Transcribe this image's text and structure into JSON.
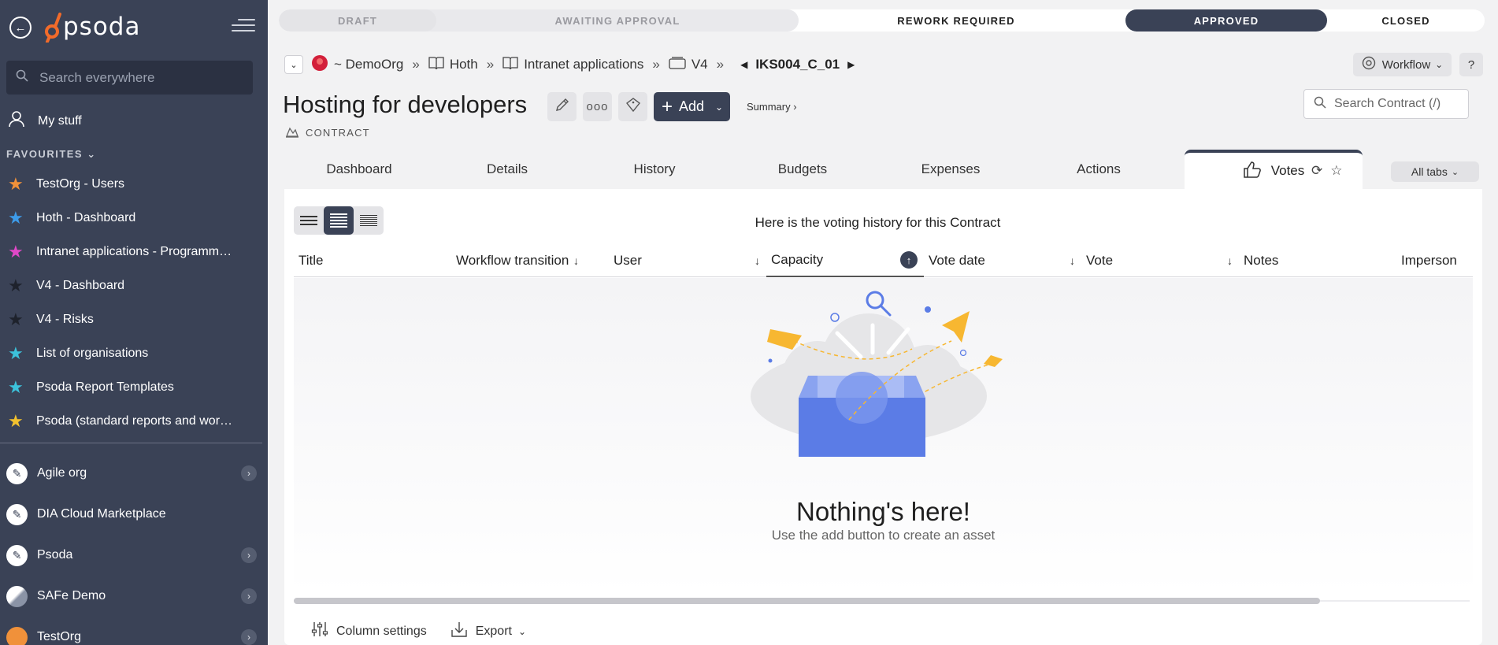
{
  "sidebar": {
    "logo_text": "psoda",
    "search_placeholder": "Search everywhere",
    "mystuff_label": "My stuff",
    "favourites_heading": "FAVOURITES",
    "favourites": [
      {
        "label": "TestOrg - Users",
        "color": "#f0913a"
      },
      {
        "label": "Hoth - Dashboard",
        "color": "#3d9be9"
      },
      {
        "label": "Intranet applications - Programme...",
        "color": "#e048c8"
      },
      {
        "label": "V4 - Dashboard",
        "color": "#2a2f3c"
      },
      {
        "label": "V4 - Risks",
        "color": "#2a2f3c"
      },
      {
        "label": "List of organisations",
        "color": "#3cc3dc"
      },
      {
        "label": "Psoda Report Templates",
        "color": "#3cc3dc"
      },
      {
        "label": "Psoda (standard reports and work...",
        "color": "#f2c12e"
      }
    ],
    "orgs": [
      {
        "label": "Agile org",
        "has_children": true
      },
      {
        "label": "DIA Cloud Marketplace",
        "has_children": false
      },
      {
        "label": "Psoda",
        "has_children": true
      },
      {
        "label": "SAFe Demo",
        "has_children": true
      },
      {
        "label": "TestOrg",
        "has_children": true
      }
    ]
  },
  "status_bar": {
    "stages": [
      "DRAFT",
      "AWAITING APPROVAL",
      "REWORK REQUIRED",
      "APPROVED",
      "CLOSED"
    ],
    "current": "APPROVED"
  },
  "breadcrumb": {
    "items": [
      "~ DemoOrg",
      "Hoth",
      "Intranet applications",
      "V4"
    ],
    "current": "IKS004_C_01"
  },
  "header": {
    "title": "Hosting for developers",
    "type_label": "CONTRACT",
    "add_label": "Add",
    "summary_label": "Summary ›",
    "workflow_label": "Workflow",
    "help_label": "?",
    "search_placeholder": "Search Contract (/)"
  },
  "tabs": [
    "Dashboard",
    "Details",
    "History",
    "Budgets",
    "Expenses",
    "Actions",
    "Votes"
  ],
  "active_tab": "Votes",
  "all_tabs_label": "All tabs",
  "panel": {
    "intro": "Here is the voting history for this Contract",
    "columns": [
      "Title",
      "Workflow transition",
      "User",
      "Capacity",
      "Vote date",
      "Vote",
      "Notes",
      "Imperson"
    ],
    "empty_title": "Nothing's here!",
    "empty_subtitle": "Use the add button to create an asset",
    "column_settings_label": "Column settings",
    "export_label": "Export"
  },
  "colors": {
    "sidebar_bg": "#3a4256",
    "accent_orange": "#f26b2a",
    "approved_bg": "#3a4256",
    "illustration_blue": "#5b7ce6",
    "illustration_yellow": "#f7b731"
  }
}
